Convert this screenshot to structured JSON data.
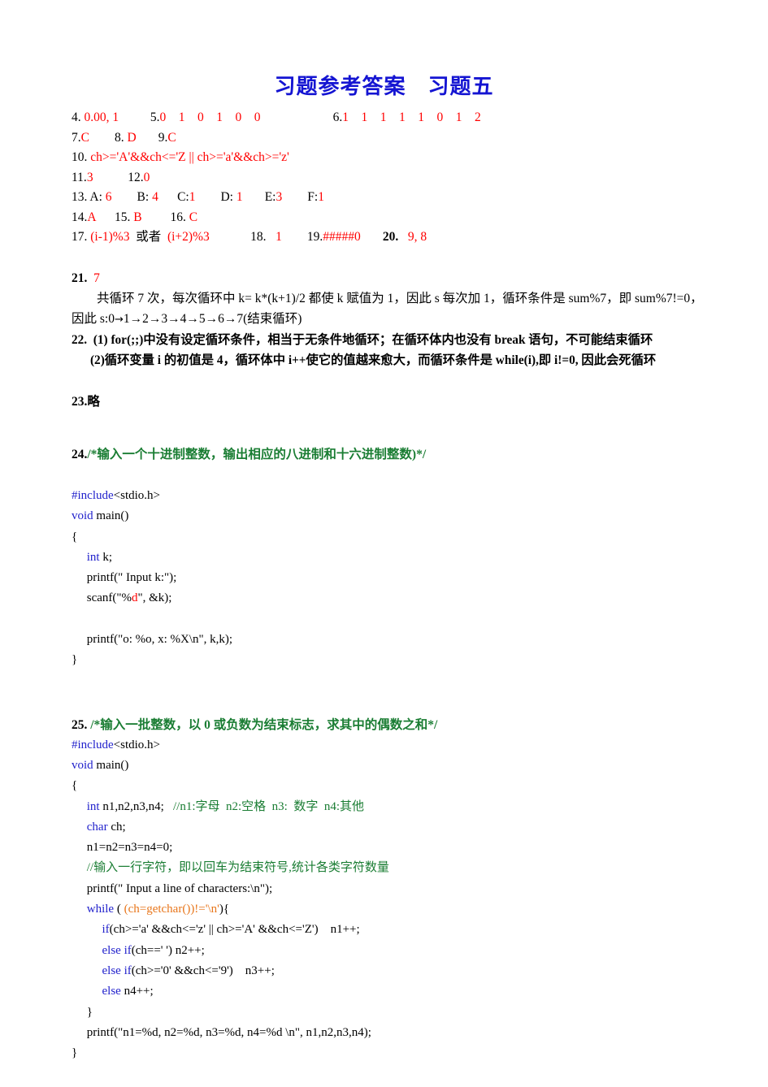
{
  "document": {
    "title": "习题参考答案　习题五",
    "title_color": "#1414d2"
  },
  "answers_short": {
    "line1": {
      "q4_num": "4. ",
      "q4_ans": "0.00, 1",
      "q5_num": "5.",
      "q5_ans": "0    1    0    1    0    0",
      "q6_num": "6.",
      "q6_ans": "1    1    1    1    1    0    1    2"
    },
    "line2": {
      "q7_num": "7.",
      "q7_ans": "C",
      "q8_num": "8. ",
      "q8_ans": "D",
      "q9_num": "9.",
      "q9_ans": "C"
    },
    "line3": {
      "q10_num": "10. ",
      "q10_ans": "ch>='A'&&ch<='Z || ch>='a'&&ch>='z'"
    },
    "line4": {
      "q11_num": "11.",
      "q11_ans": "3",
      "q12_num": "12.",
      "q12_ans": "0"
    },
    "line5": {
      "q13_num": "13. ",
      "items": [
        {
          "label": "A: ",
          "value": "6"
        },
        {
          "label": "B: ",
          "value": "4"
        },
        {
          "label": "C:",
          "value": "1"
        },
        {
          "label": "D: ",
          "value": "1"
        },
        {
          "label": "E:",
          "value": "3"
        },
        {
          "label": "F:",
          "value": "1"
        }
      ]
    },
    "line6": {
      "q14_num": "14.",
      "q14_ans": "A",
      "q15_num": "15. ",
      "q15_ans": "B",
      "q16_num": "16. ",
      "q16_ans": "C"
    },
    "line7": {
      "q17_num": "17. ",
      "q17_ans_a": "(i-1)%3",
      "q17_mid": "或者",
      "q17_ans_b": "(i+2)%3",
      "q18_num": "18. ",
      "q18_ans": "1",
      "q19_num": "19.",
      "q19_ans": "#####0",
      "q20_num": "20.",
      "q20_ans": "9, 8"
    }
  },
  "q21": {
    "number": "21.",
    "answer": "7",
    "explain_line1": "共循环 7 次，每次循环中 k= k*(k+1)/2 都使 k 赋值为 1，因此 s 每次加 1，循环条件是 sum%7，即 sum%7!=0，",
    "explain_line2_prefix": "因此 s:0",
    "explain_line2_chain": "1→2→3→4→5→6→7(结束循环)"
  },
  "q22": {
    "number": "22.",
    "item1": "(1) for(;;)中没有设定循环条件，相当于无条件地循环；在循环体内也没有 break 语句，不可能结束循环",
    "item2": "(2)循环变量 i 的初值是 4，循环体中 i++使它的值越来愈大，而循环条件是 while(i),即 i!=0, 因此会死循环"
  },
  "q23": {
    "text": "23.略"
  },
  "q24": {
    "number": "24.",
    "comment": "/*输入一个十进制整数，输出相应的八进制和十六进制整数)*/",
    "code": [
      {
        "parts": [
          {
            "t": "#include",
            "c": "blue"
          },
          {
            "t": "<stdio.h>",
            "c": "plain"
          }
        ]
      },
      {
        "parts": [
          {
            "t": "void ",
            "c": "blue"
          },
          {
            "t": "main()",
            "c": "plain"
          }
        ]
      },
      {
        "parts": [
          {
            "t": "{",
            "c": "plain"
          }
        ]
      },
      {
        "parts": [
          {
            "t": "     ",
            "c": "plain"
          },
          {
            "t": "int ",
            "c": "blue"
          },
          {
            "t": "k;",
            "c": "plain"
          }
        ]
      },
      {
        "parts": [
          {
            "t": "     printf(\" Input k:\");",
            "c": "plain"
          }
        ]
      },
      {
        "parts": [
          {
            "t": "     scanf(\"%",
            "c": "plain"
          },
          {
            "t": "d",
            "c": "red"
          },
          {
            "t": "\", &k);",
            "c": "plain"
          }
        ]
      },
      {
        "parts": [
          {
            "t": " ",
            "c": "plain"
          }
        ]
      },
      {
        "parts": [
          {
            "t": "     printf(\"o: %o, x: %X\\n\", k,k);",
            "c": "plain"
          }
        ]
      },
      {
        "parts": [
          {
            "t": "}",
            "c": "plain"
          }
        ]
      }
    ]
  },
  "q25": {
    "number": "25.",
    "comment": "/*输入一批整数，以 0 或负数为结束标志，求其中的偶数之和*/",
    "code": [
      {
        "parts": [
          {
            "t": "#include",
            "c": "blue"
          },
          {
            "t": "<stdio.h>",
            "c": "plain"
          }
        ]
      },
      {
        "parts": [
          {
            "t": "void ",
            "c": "blue"
          },
          {
            "t": "main()",
            "c": "plain"
          }
        ]
      },
      {
        "parts": [
          {
            "t": "{",
            "c": "plain"
          }
        ]
      },
      {
        "parts": [
          {
            "t": "     ",
            "c": "plain"
          },
          {
            "t": "int ",
            "c": "blue"
          },
          {
            "t": "n1,n2,n3,n4;   ",
            "c": "plain"
          },
          {
            "t": "//n1:字母  n2:空格  n3:  数字  n4:其他",
            "c": "green"
          }
        ]
      },
      {
        "parts": [
          {
            "t": "     ",
            "c": "plain"
          },
          {
            "t": "char ",
            "c": "blue"
          },
          {
            "t": "ch;",
            "c": "plain"
          }
        ]
      },
      {
        "parts": [
          {
            "t": "     n1=n2=n3=n4=0;",
            "c": "plain"
          }
        ]
      },
      {
        "parts": [
          {
            "t": "     ",
            "c": "plain"
          },
          {
            "t": "//输入一行字符，即以回车为结束符号,统计各类字符数量",
            "c": "green"
          }
        ]
      },
      {
        "parts": [
          {
            "t": "     printf(\" Input a line of characters:\\n\");",
            "c": "plain"
          }
        ]
      },
      {
        "parts": [
          {
            "t": "     ",
            "c": "plain"
          },
          {
            "t": "while ",
            "c": "blue"
          },
          {
            "t": "( ",
            "c": "plain"
          },
          {
            "t": "(ch=getchar())!='\\n'",
            "c": "orange"
          },
          {
            "t": "){",
            "c": "plain"
          }
        ]
      },
      {
        "parts": [
          {
            "t": "          ",
            "c": "plain"
          },
          {
            "t": "if",
            "c": "blue"
          },
          {
            "t": "(ch>='a' &&ch<='z' || ch>='A' &&ch<='Z')    n1++;",
            "c": "plain"
          }
        ]
      },
      {
        "parts": [
          {
            "t": "          ",
            "c": "plain"
          },
          {
            "t": "else if",
            "c": "blue"
          },
          {
            "t": "(ch==' ') n2++;",
            "c": "plain"
          }
        ]
      },
      {
        "parts": [
          {
            "t": "          ",
            "c": "plain"
          },
          {
            "t": "else if",
            "c": "blue"
          },
          {
            "t": "(ch>='0' &&ch<='9')    n3++;",
            "c": "plain"
          }
        ]
      },
      {
        "parts": [
          {
            "t": "          ",
            "c": "plain"
          },
          {
            "t": "else ",
            "c": "blue"
          },
          {
            "t": "n4++;",
            "c": "plain"
          }
        ]
      },
      {
        "parts": [
          {
            "t": "     }",
            "c": "plain"
          }
        ]
      },
      {
        "parts": [
          {
            "t": "     printf(\"n1=%d, n2=%d, n3=%d, n4=%d \\n\", n1,n2,n3,n4);",
            "c": "plain"
          }
        ]
      },
      {
        "parts": [
          {
            "t": "}",
            "c": "plain"
          }
        ]
      }
    ]
  }
}
